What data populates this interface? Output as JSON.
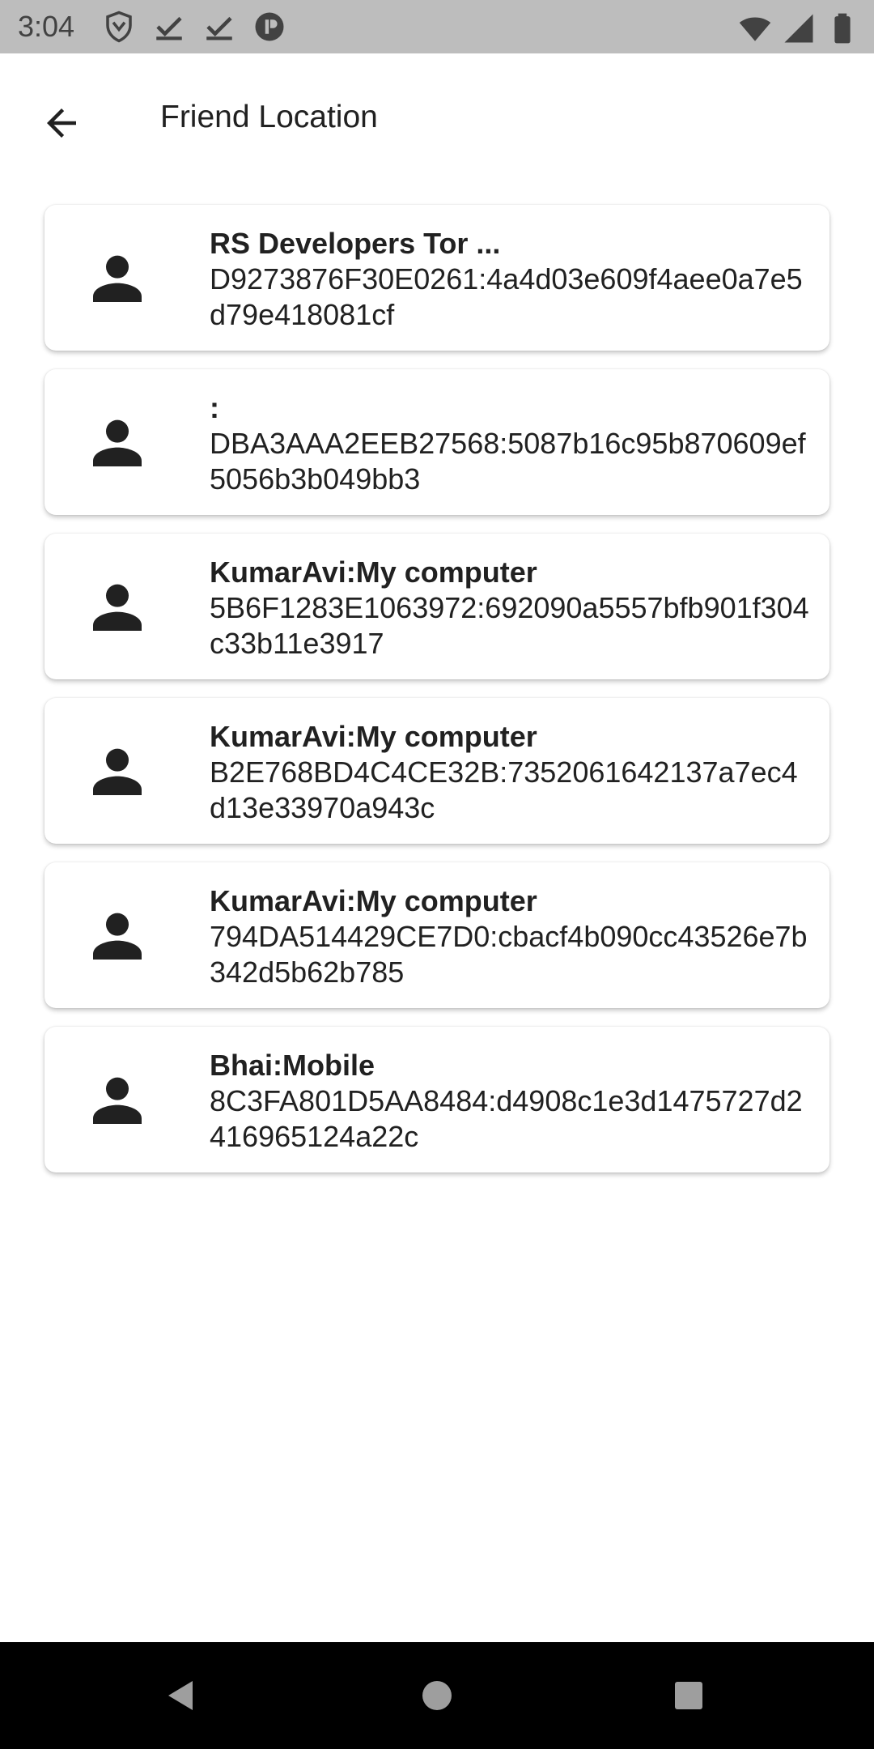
{
  "status_bar": {
    "time": "3:04",
    "left_icons": [
      "vpn-shield-icon",
      "download-check-icon",
      "download-check-icon",
      "pause-circle-icon"
    ],
    "right_icons": [
      "wifi-icon",
      "cell-signal-icon",
      "battery-icon"
    ]
  },
  "app_bar": {
    "title": "Friend Location",
    "back_icon": "arrow-back-icon"
  },
  "friends": [
    {
      "title": "RS Developers Tor ...",
      "id": "D9273876F30E0261:4a4d03e609f4aee0a7e5d79e418081cf"
    },
    {
      "title": ":",
      "id": "DBA3AAA2EEB27568:5087b16c95b870609ef5056b3b049bb3"
    },
    {
      "title": "KumarAvi:My computer",
      "id": "5B6F1283E1063972:692090a5557bfb901f304c33b11e3917"
    },
    {
      "title": "KumarAvi:My computer",
      "id": "B2E768BD4C4CE32B:7352061642137a7ec4d13e33970a943c"
    },
    {
      "title": "KumarAvi:My computer",
      "id": "794DA514429CE7D0:cbacf4b090cc43526e7b342d5b62b785"
    },
    {
      "title": "Bhai:Mobile",
      "id": "8C3FA801D5AA8484:d4908c1e3d1475727d2416965124a22c"
    }
  ],
  "nav_bar": {
    "icons": [
      "back-triangle-icon",
      "home-circle-icon",
      "recents-square-icon"
    ]
  },
  "colors": {
    "status_bar_bg": "#bdbdbd",
    "nav_bar_bg": "#000000",
    "text": "#212121"
  }
}
